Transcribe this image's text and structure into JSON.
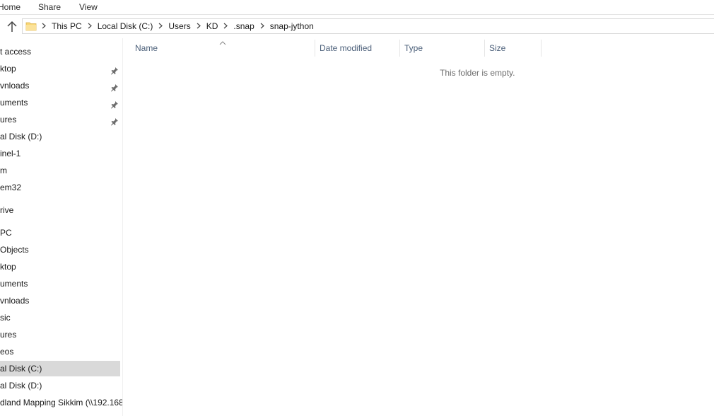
{
  "ribbon": {
    "tabs": [
      "Home",
      "Share",
      "View"
    ]
  },
  "address": {
    "crumbs": [
      "This PC",
      "Local Disk (C:)",
      "Users",
      "KD",
      ".snap",
      "snap-jython"
    ]
  },
  "nav": {
    "items": [
      {
        "label": "t access",
        "pinned": false
      },
      {
        "label": "ktop",
        "pinned": true
      },
      {
        "label": "vnloads",
        "pinned": true
      },
      {
        "label": "uments",
        "pinned": true
      },
      {
        "label": "ures",
        "pinned": true
      },
      {
        "label": "al Disk (D:)",
        "pinned": false
      },
      {
        "label": "inel-1",
        "pinned": false
      },
      {
        "label": "m",
        "pinned": false
      },
      {
        "label": "em32",
        "pinned": false
      },
      {
        "label": "rive",
        "pinned": false
      },
      {
        "label": "PC",
        "pinned": false
      },
      {
        "label": "Objects",
        "pinned": false
      },
      {
        "label": "ktop",
        "pinned": false
      },
      {
        "label": "uments",
        "pinned": false
      },
      {
        "label": "vnloads",
        "pinned": false
      },
      {
        "label": "sic",
        "pinned": false
      },
      {
        "label": "ures",
        "pinned": false
      },
      {
        "label": "eos",
        "pinned": false
      },
      {
        "label": "al Disk (C:)",
        "pinned": false,
        "selected": true
      },
      {
        "label": "al Disk (D:)",
        "pinned": false
      },
      {
        "label": "dland Mapping Sikkim (\\\\192.168.",
        "pinned": false
      }
    ]
  },
  "columns": {
    "name": "Name",
    "date_modified": "Date modified",
    "type": "Type",
    "size": "Size"
  },
  "content": {
    "empty_message": "This folder is empty."
  },
  "icons": {
    "up": "up-arrow-icon",
    "folder": "folder-icon",
    "separator": "chevron-right-icon",
    "pin": "pin-icon",
    "sort": "sort-ascending-icon"
  },
  "colors": {
    "selected_bg": "#d9d9d9",
    "folder_yellow": "#f8d775",
    "header_text": "#4c607a"
  }
}
